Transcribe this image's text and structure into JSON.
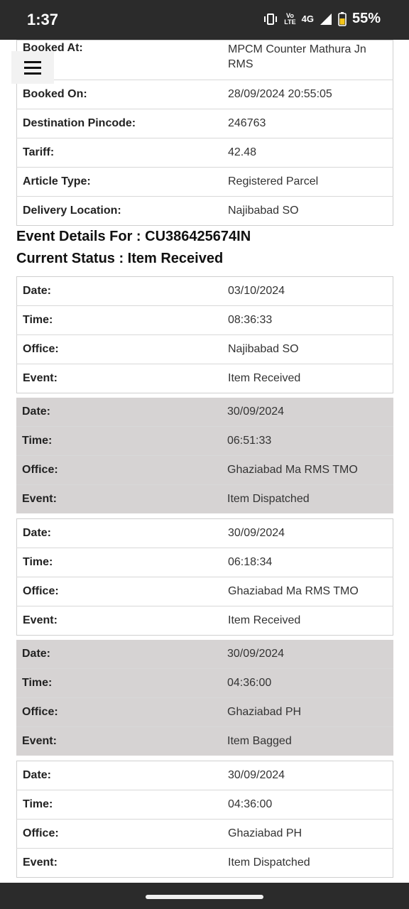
{
  "status_bar": {
    "time": "1:37",
    "volte_top": "Vo",
    "volte_bottom": "LTE",
    "network": "4G",
    "battery": "55%"
  },
  "booking_details": [
    {
      "label": "Booked At:",
      "value": "MPCM Counter Mathura Jn RMS"
    },
    {
      "label": "Booked On:",
      "value": "28/09/2024 20:55:05"
    },
    {
      "label": "Destination Pincode:",
      "value": "246763"
    },
    {
      "label": "Tariff:",
      "value": "42.48"
    },
    {
      "label": "Article Type:",
      "value": "Registered Parcel"
    },
    {
      "label": "Delivery Location:",
      "value": "Najibabad SO"
    }
  ],
  "event_heading": "Event Details For : CU386425674IN",
  "status_heading": "Current Status : Item Received",
  "labels": {
    "date": "Date:",
    "time": "Time:",
    "office": "Office:",
    "event": "Event:"
  },
  "events": [
    {
      "date": "03/10/2024",
      "time": "08:36:33",
      "office": "Najibabad SO",
      "event": "Item Received"
    },
    {
      "date": "30/09/2024",
      "time": "06:51:33",
      "office": "Ghaziabad Ma RMS TMO",
      "event": "Item Dispatched"
    },
    {
      "date": "30/09/2024",
      "time": "06:18:34",
      "office": "Ghaziabad Ma RMS TMO",
      "event": "Item Received"
    },
    {
      "date": "30/09/2024",
      "time": "04:36:00",
      "office": "Ghaziabad PH",
      "event": "Item Bagged"
    },
    {
      "date": "30/09/2024",
      "time": "04:36:00",
      "office": "Ghaziabad PH",
      "event": "Item Dispatched"
    }
  ]
}
